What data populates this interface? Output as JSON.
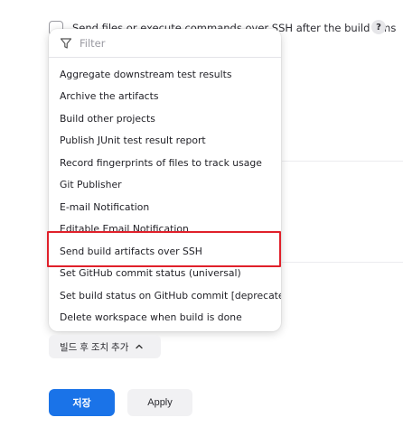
{
  "background": {
    "option_label": "Send files or execute commands over SSH after the build runs",
    "help_label": "?"
  },
  "menu": {
    "filter_placeholder": "Filter",
    "items": [
      "Aggregate downstream test results",
      "Archive the artifacts",
      "Build other projects",
      "Publish JUnit test result report",
      "Record fingerprints of files to track usage",
      "Git Publisher",
      "E-mail Notification",
      "Editable Email Notification",
      "Send build artifacts over SSH",
      "Set GitHub commit status (universal)",
      "Set build status on GitHub commit [deprecated]",
      "Delete workspace when build is done"
    ],
    "highlighted_item": "Send build artifacts over SSH"
  },
  "actions": {
    "add_post_build_label": "빌드 후 조치 추가",
    "save_label": "저장",
    "apply_label": "Apply"
  },
  "colors": {
    "primary": "#1a73e8",
    "highlight_border": "#e0202a"
  }
}
